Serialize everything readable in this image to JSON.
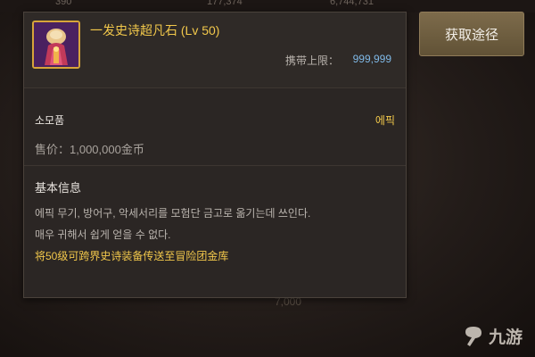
{
  "background": {
    "top_numbers": [
      "390",
      "177,374",
      "6,744,731"
    ],
    "ghost_amount": "7,000"
  },
  "item": {
    "name": "一发史诗超凡石 (Lv 50)",
    "icon": "epic-stone-icon",
    "carry_limit_label": "携带上限：",
    "carry_limit_value": "999,999",
    "category": "소모품",
    "rarity": "에픽",
    "price": "售价：1,000,000金币"
  },
  "info": {
    "heading": "基本信息",
    "lines": [
      "에픽 무기, 방어구, 악세서리를 모험단 금고로 옮기는데 쓰인다.",
      "매우 귀해서 쉽게 얻을 수 없다.",
      "将50级可跨界史诗装备传送至冒险团金库"
    ]
  },
  "actions": {
    "acquire_label": "获取途径"
  },
  "watermark": {
    "text": "九游"
  },
  "colors": {
    "panel_bg": "#2b2624",
    "title_gold": "#f2c84b",
    "value_blue": "#7fb8e6",
    "button_bg": "#6f5e40"
  }
}
